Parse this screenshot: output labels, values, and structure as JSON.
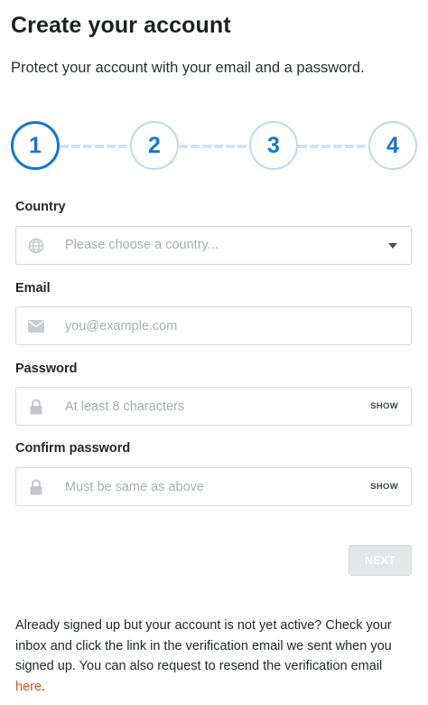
{
  "header": {
    "title": "Create your account",
    "subtitle": "Protect your account with your email and a password."
  },
  "stepper": {
    "steps": [
      "1",
      "2",
      "3",
      "4"
    ],
    "active_step": 1,
    "accent_color": "#1476d2"
  },
  "form": {
    "country": {
      "label": "Country",
      "placeholder": "Please choose a country...",
      "icon": "globe-icon"
    },
    "email": {
      "label": "Email",
      "placeholder": "you@example.com",
      "value": "",
      "icon": "envelope-icon"
    },
    "password": {
      "label": "Password",
      "placeholder": "At least 8 characters",
      "value": "",
      "show_label": "SHOW",
      "icon": "lock-icon"
    },
    "confirm_password": {
      "label": "Confirm password",
      "placeholder": "Must be same as above",
      "value": "",
      "show_label": "SHOW",
      "icon": "lock-icon"
    }
  },
  "actions": {
    "next_label": "NEXT",
    "next_disabled": true
  },
  "footer": {
    "note_text": "Already signed up but your account is not yet active? Check your inbox and click the link in the verification email we sent when you signed up. You can also request to resend the verification email ",
    "link_text": "here",
    "note_end": ".",
    "link_color": "#e0531d"
  }
}
